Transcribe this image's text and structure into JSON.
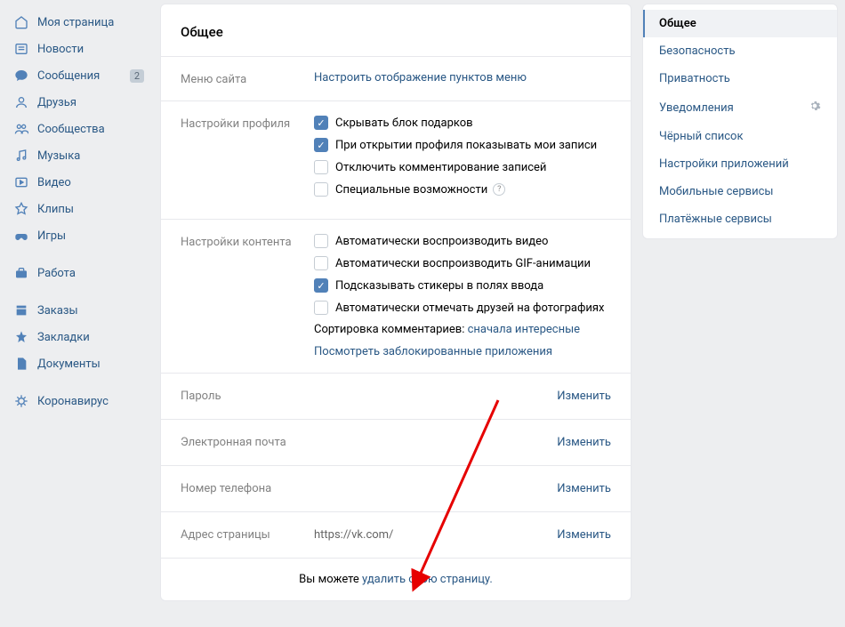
{
  "leftnav": {
    "items": [
      {
        "icon": "home",
        "label": "Моя страница"
      },
      {
        "icon": "news",
        "label": "Новости"
      },
      {
        "icon": "msg",
        "label": "Сообщения",
        "badge": "2"
      },
      {
        "icon": "friends",
        "label": "Друзья"
      },
      {
        "icon": "groups",
        "label": "Сообщества"
      },
      {
        "icon": "music",
        "label": "Музыка"
      },
      {
        "icon": "video",
        "label": "Видео"
      },
      {
        "icon": "clips",
        "label": "Клипы"
      },
      {
        "icon": "games",
        "label": "Игры"
      }
    ],
    "items2": [
      {
        "icon": "work",
        "label": "Работа"
      }
    ],
    "items3": [
      {
        "icon": "orders",
        "label": "Заказы"
      },
      {
        "icon": "bookmark",
        "label": "Закладки"
      },
      {
        "icon": "docs",
        "label": "Документы"
      }
    ],
    "items4": [
      {
        "icon": "covid",
        "label": "Коронавирус"
      }
    ]
  },
  "main": {
    "title": "Общее",
    "menu_section": {
      "label": "Меню сайта",
      "link": "Настроить отображение пунктов меню"
    },
    "profile_section": {
      "label": "Настройки профиля",
      "checks": [
        {
          "label": "Скрывать блок подарков",
          "checked": true
        },
        {
          "label": "При открытии профиля показывать мои записи",
          "checked": true
        },
        {
          "label": "Отключить комментирование записей",
          "checked": false
        },
        {
          "label": "Специальные возможности",
          "checked": false,
          "help": true
        }
      ]
    },
    "content_section": {
      "label": "Настройки контента",
      "checks": [
        {
          "label": "Автоматически воспроизводить видео",
          "checked": false
        },
        {
          "label": "Автоматически воспроизводить GIF-анимации",
          "checked": false
        },
        {
          "label": "Подсказывать стикеры в полях ввода",
          "checked": true
        },
        {
          "label": "Автоматически отмечать друзей на фотографиях",
          "checked": false
        }
      ],
      "sort_prefix": "Сортировка комментариев: ",
      "sort_link": "сначала интересные",
      "blocked_link": "Посмотреть заблокированные приложения"
    },
    "rows": [
      {
        "label": "Пароль",
        "value": "",
        "action": "Изменить"
      },
      {
        "label": "Электронная почта",
        "value": "",
        "action": "Изменить"
      },
      {
        "label": "Номер телефона",
        "value": "",
        "action": "Изменить"
      },
      {
        "label": "Адрес страницы",
        "value": "https://vk.com/",
        "action": "Изменить"
      }
    ],
    "footer": {
      "prefix": "Вы можете ",
      "link": "удалить свою страницу."
    }
  },
  "rightnav": {
    "items": [
      {
        "label": "Общее",
        "active": true
      },
      {
        "label": "Безопасность"
      },
      {
        "label": "Приватность"
      },
      {
        "label": "Уведомления",
        "gear": true
      },
      {
        "label": "Чёрный список"
      },
      {
        "label": "Настройки приложений"
      },
      {
        "label": "Мобильные сервисы"
      },
      {
        "label": "Платёжные сервисы"
      }
    ]
  }
}
